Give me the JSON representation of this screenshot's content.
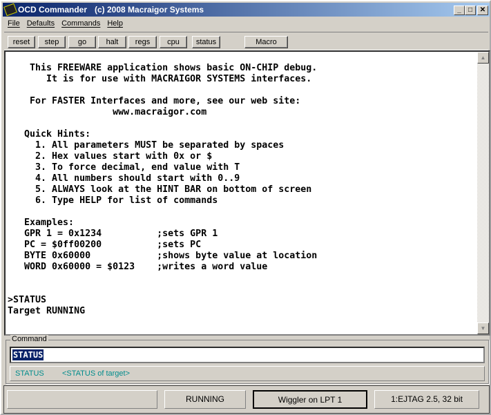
{
  "title": {
    "app": "OCD Commander",
    "copyright": "(c) 2008 Macraigor Systems"
  },
  "window_buttons": {
    "minimize": "_",
    "maximize": "□",
    "close": "✕"
  },
  "menu": [
    "File",
    "Defaults",
    "Commands",
    "Help"
  ],
  "toolbar": [
    "reset",
    "step",
    "go",
    "halt",
    "regs",
    "cpu",
    "status",
    "Macro"
  ],
  "console_lines": [
    "    This FREEWARE application shows basic ON-CHIP debug.",
    "       It is for use with MACRAIGOR SYSTEMS interfaces.",
    "",
    "    For FASTER Interfaces and more, see our web site:",
    "                   www.macraigor.com",
    "",
    "   Quick Hints:",
    "     1. All parameters MUST be separated by spaces",
    "     2. Hex values start with 0x or $",
    "     3. To force decimal, end value with T",
    "     4. All numbers should start with 0..9",
    "     5. ALWAYS look at the HINT BAR on bottom of screen",
    "     6. Type HELP for list of commands",
    "",
    "   Examples:",
    "   GPR 1 = 0x1234          ;sets GPR 1",
    "   PC = $0ff00200          ;sets PC",
    "   BYTE 0x60000            ;shows byte value at location",
    "   WORD 0x60000 = $0123    ;writes a word value",
    "",
    "",
    ">STATUS",
    "Target RUNNING"
  ],
  "command": {
    "label": "Command",
    "value": "STATUS",
    "hint_cmd": "STATUS",
    "hint_desc": "<STATUS of target>"
  },
  "statusbar": {
    "panel1": "",
    "state": "RUNNING",
    "interface": "Wiggler on LPT 1",
    "target": "1:EJTAG 2.5, 32 bit"
  }
}
